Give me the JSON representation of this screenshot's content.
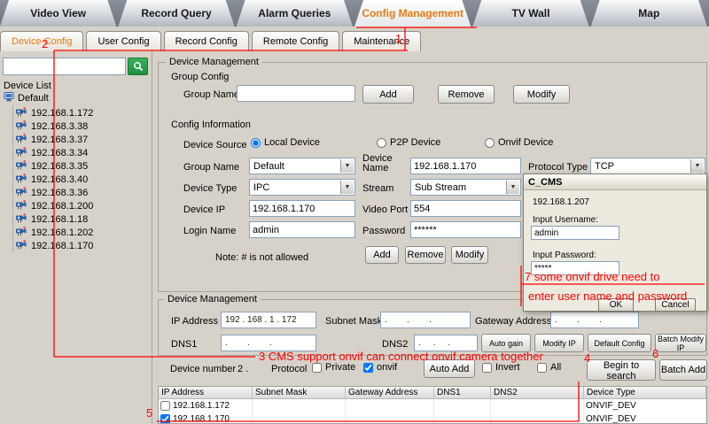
{
  "top_tabs": [
    {
      "label": "Video View"
    },
    {
      "label": "Record Query"
    },
    {
      "label": "Alarm Queries"
    },
    {
      "label": "Config Management"
    },
    {
      "label": "TV Wall"
    },
    {
      "label": "Map"
    }
  ],
  "sub_tabs": [
    {
      "label": "Device Config"
    },
    {
      "label": "User Config"
    },
    {
      "label": "Record Config"
    },
    {
      "label": "Remote Config"
    },
    {
      "label": "Maintenance"
    }
  ],
  "sidebar": {
    "device_list_label": "Device List",
    "root": "Default",
    "devices": [
      "192.168.1.172",
      "192.168.3.38",
      "192.168.3.37",
      "192.168.3.34",
      "192.168.3.35",
      "192.168.3.40",
      "192.168.3.36",
      "192.168.1.200",
      "192.168.1.18",
      "192.168.1.202",
      "192.168.1.170"
    ]
  },
  "section_title": "Device Management",
  "group_config": {
    "label": "Group Config",
    "group_name_label": "Group Name",
    "group_name_value": "",
    "add": "Add",
    "remove": "Remove",
    "modify": "Modify"
  },
  "config_information": {
    "label": "Config Information",
    "device_source_label": "Device Source",
    "radio_local": "Local Device",
    "radio_local_checked": true,
    "radio_p2p": "P2P Device",
    "radio_p2p_checked": false,
    "radio_onvif": "Onvif Device",
    "radio_onvif_checked": false,
    "group_name_label": "Group Name",
    "group_name_value": "Default",
    "device_name_label": "Device Name",
    "device_name_value": "192.168.1.170",
    "protocol_type_label": "Protocol Type",
    "protocol_type_value": "TCP",
    "device_type_label": "Device Type",
    "device_type_value": "IPC",
    "stream_label": "Stream",
    "stream_value": "Sub Stream",
    "device_ip_label": "Device IP",
    "device_ip_value": "192.168.1.170",
    "video_port_label": "Video Port",
    "video_port_value": "554",
    "login_name_label": "Login Name",
    "login_name_value": "admin",
    "password_label": "Password",
    "password_value": "******",
    "note": "Note: # is not allowed",
    "add": "Add",
    "remove": "Remove",
    "modify": "Modify"
  },
  "network": {
    "title": "Device Management",
    "ip_label": "IP Address",
    "ip_value": "192 . 168 . 1 . 172",
    "subnet_label": "Subnet Mask",
    "subnet_value": ".        .        .",
    "gateway_label": "Gateway Address",
    "gateway_value": ".        .        .",
    "dns1_label": "DNS1",
    "dns1_value": ".        .        .",
    "dns2_label": "DNS2",
    "dns2_value": ".     .     .",
    "auto_gain": "Auto gain",
    "modify_ip": "Modify IP",
    "default_config": "Default Config",
    "batch_modify_ip": "Batch Modify IP"
  },
  "search_row": {
    "device_number_label": "Device number",
    "device_number_value": "2 .",
    "protocol_label": "Protocol",
    "private_label": "Private",
    "private_checked": false,
    "onvif_label": "onvif",
    "onvif_checked": true,
    "auto_add": "Auto Add",
    "invert_label": "Invert",
    "invert_checked": false,
    "all_label": "All",
    "all_checked": false,
    "begin_search": "Begin to search",
    "batch_add": "Batch Add"
  },
  "results_table": {
    "columns": [
      "IP Address",
      "Subnet Mask",
      "Gateway Address",
      "DNS1",
      "DNS2",
      "Device Type"
    ],
    "rows": [
      {
        "checked": false,
        "ip": "192.168.1.172",
        "type": "ONVIF_DEV"
      },
      {
        "checked": true,
        "ip": "192.168.1.170",
        "type": "ONVIF_DEV"
      }
    ]
  },
  "dialog": {
    "title": "C_CMS",
    "ip": "192.168.1.207",
    "username_label": "Input Username:",
    "username_value": "admin",
    "password_label": "Input Password:",
    "password_value": "*****",
    "ok": "OK",
    "cancel": "Cancel"
  },
  "annotations": {
    "color": "#ff0000",
    "n1": "1",
    "n2": "2",
    "n3": "3 CMS support onvif can connect onvif camera together",
    "n4": "4",
    "n5": "5",
    "n6": "6",
    "n7a": "7 some onvif drive need to",
    "n7b": "enter user name and password"
  }
}
